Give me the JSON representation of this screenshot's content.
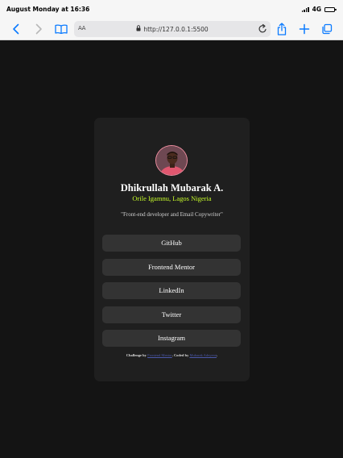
{
  "status_bar": {
    "time": "August Monday at 16:36",
    "network": "4G"
  },
  "browser": {
    "text_size_label": "AA",
    "url": "http://127.0.0.1:5500"
  },
  "profile": {
    "name": "Dhikrullah Mubarak A.",
    "location": "Orile Igamnu, Lagos Nigeria",
    "bio": "\"Front-end developer and Email Copywriter\""
  },
  "links": [
    {
      "label": "GitHub"
    },
    {
      "label": "Frontend Mentor"
    },
    {
      "label": "LinkedIn"
    },
    {
      "label": "Twitter"
    },
    {
      "label": "Instagram"
    }
  ],
  "footer": {
    "challenge_prefix": "Challenge by ",
    "challenge_link": "Frontend Mentor",
    "coded_prefix": ". Coded by ",
    "coder_link": "Mubarak Adeyemi",
    "suffix": "."
  },
  "colors": {
    "page_bg": "#141414",
    "card_bg": "#1f1f1f",
    "button_bg": "#333333",
    "accent": "#c4f82a",
    "browser_blue": "#0a7aff"
  },
  "icons": [
    "back-icon",
    "forward-icon",
    "bookmarks-icon",
    "lock-icon",
    "reload-icon",
    "share-icon",
    "new-tab-icon",
    "tabs-icon"
  ]
}
